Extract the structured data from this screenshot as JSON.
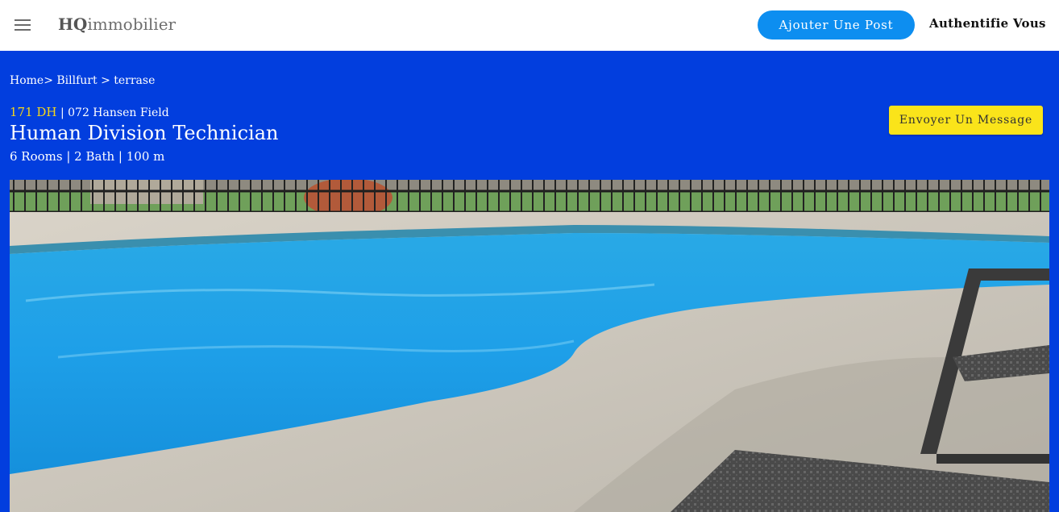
{
  "header": {
    "brand_bold": "HQ",
    "brand_rest": "immobilier",
    "post_button": "Ajouter Une Post",
    "auth_link": "Authentifie Vous"
  },
  "listing": {
    "breadcrumb": [
      "Home>",
      "Billfurt >",
      "terrase"
    ],
    "price": "171 DH",
    "address": "| 072 Hansen Field",
    "title": "Human Division Technician",
    "specs": "6 Rooms | 2 Bath | 100 m",
    "message_button": "Envoyer Un Message"
  },
  "colors": {
    "hero_background": "#023ede",
    "primary_button": "#0d8ef0",
    "accent_yellow": "#fae41a",
    "price_text": "#f5d619"
  },
  "icons": {
    "menu": "menu-icon"
  }
}
